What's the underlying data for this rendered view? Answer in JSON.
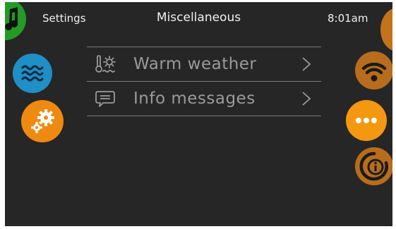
{
  "header": {
    "left_label": "Settings",
    "title": "Miscellaneous",
    "time": "8:01am"
  },
  "left_dock": [
    {
      "icon": "music-note-icon",
      "color": "#239b25"
    },
    {
      "icon": "water-waves-icon",
      "color": "#1e8fc7"
    },
    {
      "icon": "gears-icon",
      "color": "#ef8a10"
    }
  ],
  "right_dock": [
    {
      "icon": "partial-orange-icon",
      "color": "#c3731c"
    },
    {
      "icon": "wifi-icon",
      "color": "#b86d1c"
    },
    {
      "icon": "more-dots-icon",
      "color": "#f39810"
    },
    {
      "icon": "info-icon",
      "color": "#b86d1c"
    }
  ],
  "menu": {
    "items": [
      {
        "label": "Warm weather",
        "icon": "thermometer-sun-icon"
      },
      {
        "label": "Info messages",
        "icon": "message-bubble-icon"
      }
    ]
  },
  "colors": {
    "background": "#262626",
    "text": "#e6e6e6",
    "menu_text": "#9a9a9a",
    "divider": "#7a7a7a"
  }
}
